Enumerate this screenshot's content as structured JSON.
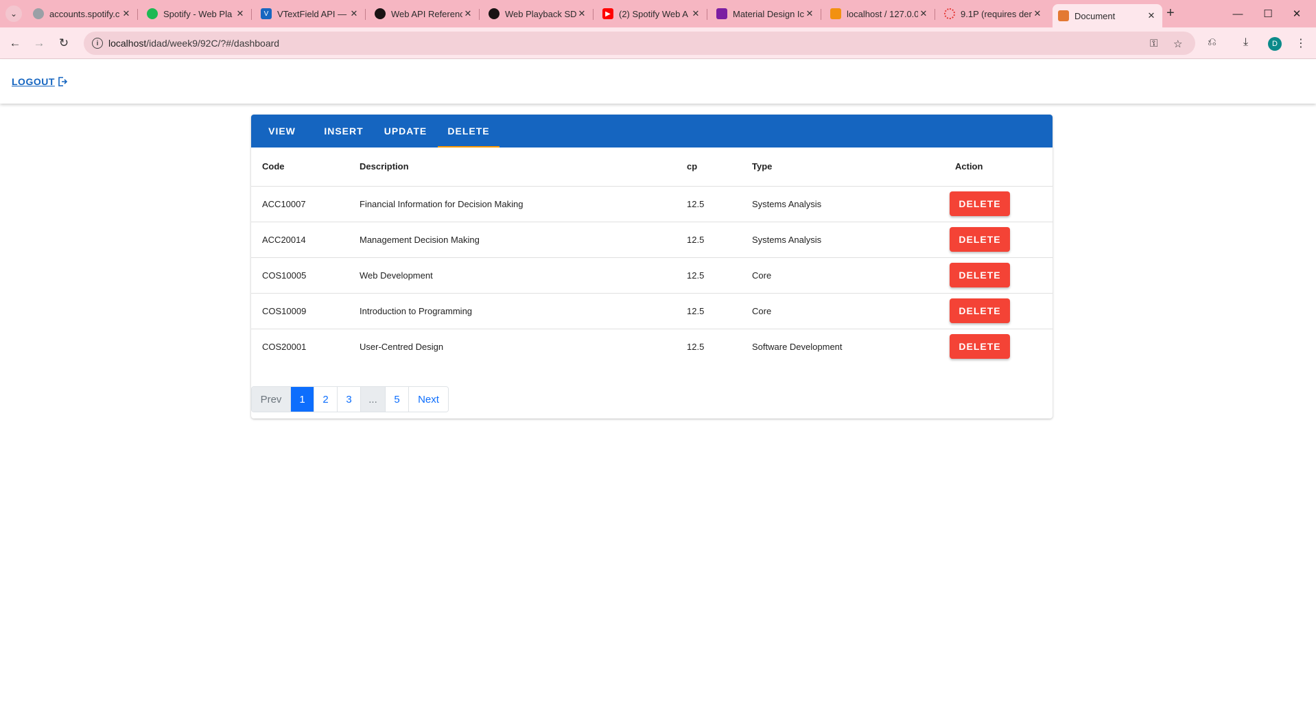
{
  "browser": {
    "tabs": [
      {
        "title": "accounts.spotify.c",
        "favicon_color": "#9aa0a6"
      },
      {
        "title": "Spotify - Web Pla",
        "favicon_color": "#1db954"
      },
      {
        "title": "VTextField API —",
        "favicon_color": "#1867c0"
      },
      {
        "title": "Web API Referenc",
        "favicon_color": "#191414"
      },
      {
        "title": "Web Playback SDI",
        "favicon_color": "#191414"
      },
      {
        "title": "(2) Spotify Web A",
        "favicon_color": "#ff0000"
      },
      {
        "title": "Material Design Ic",
        "favicon_color": "#7b1fa2"
      },
      {
        "title": "localhost / 127.0.0",
        "favicon_color": "#f29111"
      },
      {
        "title": "9.1P (requires den",
        "favicon_color": "#e53935"
      },
      {
        "title": "Document",
        "favicon_color": "#e37933"
      }
    ],
    "url_host": "localhost",
    "url_path": "/idad/week9/92C/?#/dashboard",
    "profile_initial": "D"
  },
  "app": {
    "logout_label": "LOGOUT",
    "tabs": [
      "VIEW",
      "INSERT",
      "UPDATE",
      "DELETE"
    ],
    "active_tab": "DELETE",
    "primary_color": "#1565c0",
    "accent_color": "#ff9800",
    "delete_color": "#f44336",
    "table": {
      "headers": [
        "Code",
        "Description",
        "cp",
        "Type",
        "Action"
      ],
      "rows": [
        {
          "code": "ACC10007",
          "description": "Financial Information for Decision Making",
          "cp": "12.5",
          "type": "Systems Analysis",
          "action": "DELETE"
        },
        {
          "code": "ACC20014",
          "description": "Management Decision Making",
          "cp": "12.5",
          "type": "Systems Analysis",
          "action": "DELETE"
        },
        {
          "code": "COS10005",
          "description": "Web Development",
          "cp": "12.5",
          "type": "Core",
          "action": "DELETE"
        },
        {
          "code": "COS10009",
          "description": "Introduction to Programming",
          "cp": "12.5",
          "type": "Core",
          "action": "DELETE"
        },
        {
          "code": "COS20001",
          "description": "User-Centred Design",
          "cp": "12.5",
          "type": "Software Development",
          "action": "DELETE"
        }
      ]
    },
    "pagination": {
      "prev": "Prev",
      "pages": [
        "1",
        "2",
        "3",
        "...",
        "5"
      ],
      "current": "1",
      "next": "Next"
    }
  }
}
